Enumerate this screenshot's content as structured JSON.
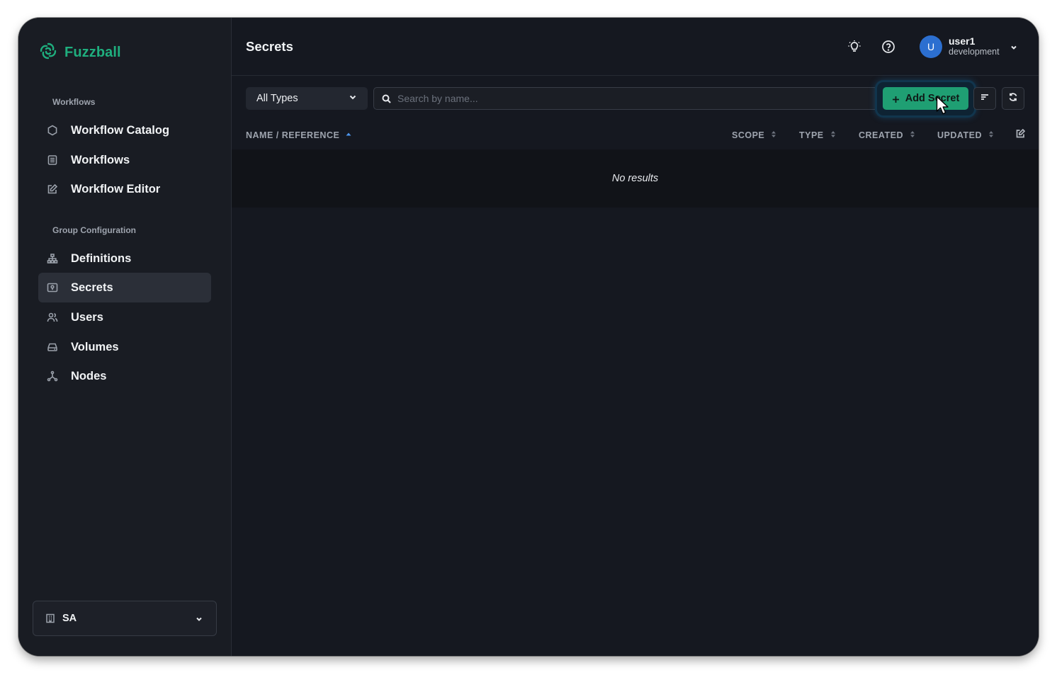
{
  "app": {
    "name": "Fuzzball",
    "brand_color": "#1fae7e"
  },
  "sidebar": {
    "sections": [
      {
        "title": "Workflows"
      },
      {
        "title": "Group Configuration"
      }
    ],
    "items": [
      {
        "label": "Workflow Catalog",
        "icon": "hexagon-icon"
      },
      {
        "label": "Workflows",
        "icon": "list-icon"
      },
      {
        "label": "Workflow Editor",
        "icon": "edit-icon"
      },
      {
        "label": "Definitions",
        "icon": "sitemap-icon"
      },
      {
        "label": "Secrets",
        "icon": "secret-icon",
        "active": true
      },
      {
        "label": "Users",
        "icon": "users-icon"
      },
      {
        "label": "Volumes",
        "icon": "drive-icon"
      },
      {
        "label": "Nodes",
        "icon": "nodes-icon"
      }
    ],
    "org": {
      "label": "SA",
      "icon": "building-icon"
    }
  },
  "header": {
    "title": "Secrets",
    "user": {
      "initial": "U",
      "name": "user1",
      "org": "development",
      "avatar_color": "#2c6fd0"
    }
  },
  "toolbar": {
    "type_filter": "All Types",
    "search_placeholder": "Search by name...",
    "search_value": "",
    "add_label": "Add Secret",
    "add_color": "#1f9f73"
  },
  "table": {
    "columns": [
      {
        "label": "NAME / REFERENCE",
        "sort": "asc"
      },
      {
        "label": "SCOPE",
        "sort": "none"
      },
      {
        "label": "TYPE",
        "sort": "none"
      },
      {
        "label": "CREATED",
        "sort": "none"
      },
      {
        "label": "UPDATED",
        "sort": "none"
      }
    ],
    "empty_text": "No results"
  }
}
